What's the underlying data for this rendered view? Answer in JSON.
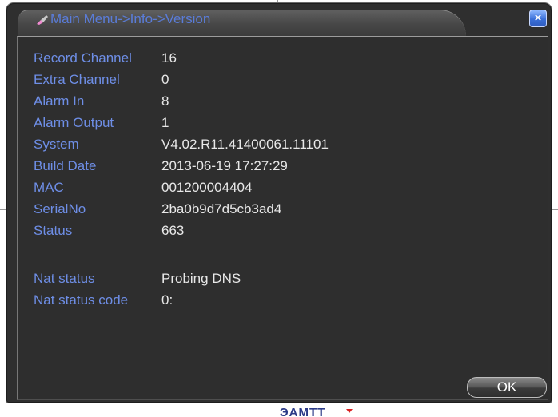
{
  "background": {
    "bottom_text": "ЭАМТТ"
  },
  "window": {
    "title": "Main Menu->Info->Version",
    "close_label": "×",
    "ok_label": "OK"
  },
  "info": {
    "rows": [
      {
        "label": "Record Channel",
        "value": "16"
      },
      {
        "label": "Extra Channel",
        "value": "0"
      },
      {
        "label": "Alarm In",
        "value": "8"
      },
      {
        "label": "Alarm Output",
        "value": "1"
      },
      {
        "label": "System",
        "value": "V4.02.R11.41400061.11101"
      },
      {
        "label": "Build Date",
        "value": "2013-06-19 17:27:29"
      },
      {
        "label": "MAC",
        "value": "001200004404"
      },
      {
        "label": "SerialNo",
        "value": "2ba0b9d7d5cb3ad4"
      },
      {
        "label": "Status",
        "value": "663"
      }
    ],
    "nat_rows": [
      {
        "label": "Nat status",
        "value": "Probing DNS"
      },
      {
        "label": "Nat status code",
        "value": "0:"
      }
    ]
  },
  "colors": {
    "label": "#6e8ee6",
    "value": "#e8e8e8",
    "panel": "#2e2e2e",
    "close_button": "#3a6fd8"
  },
  "icons": {
    "title": "menu-brush-icon",
    "close": "close-icon",
    "background_arrow": "dropdown-arrow-icon"
  }
}
